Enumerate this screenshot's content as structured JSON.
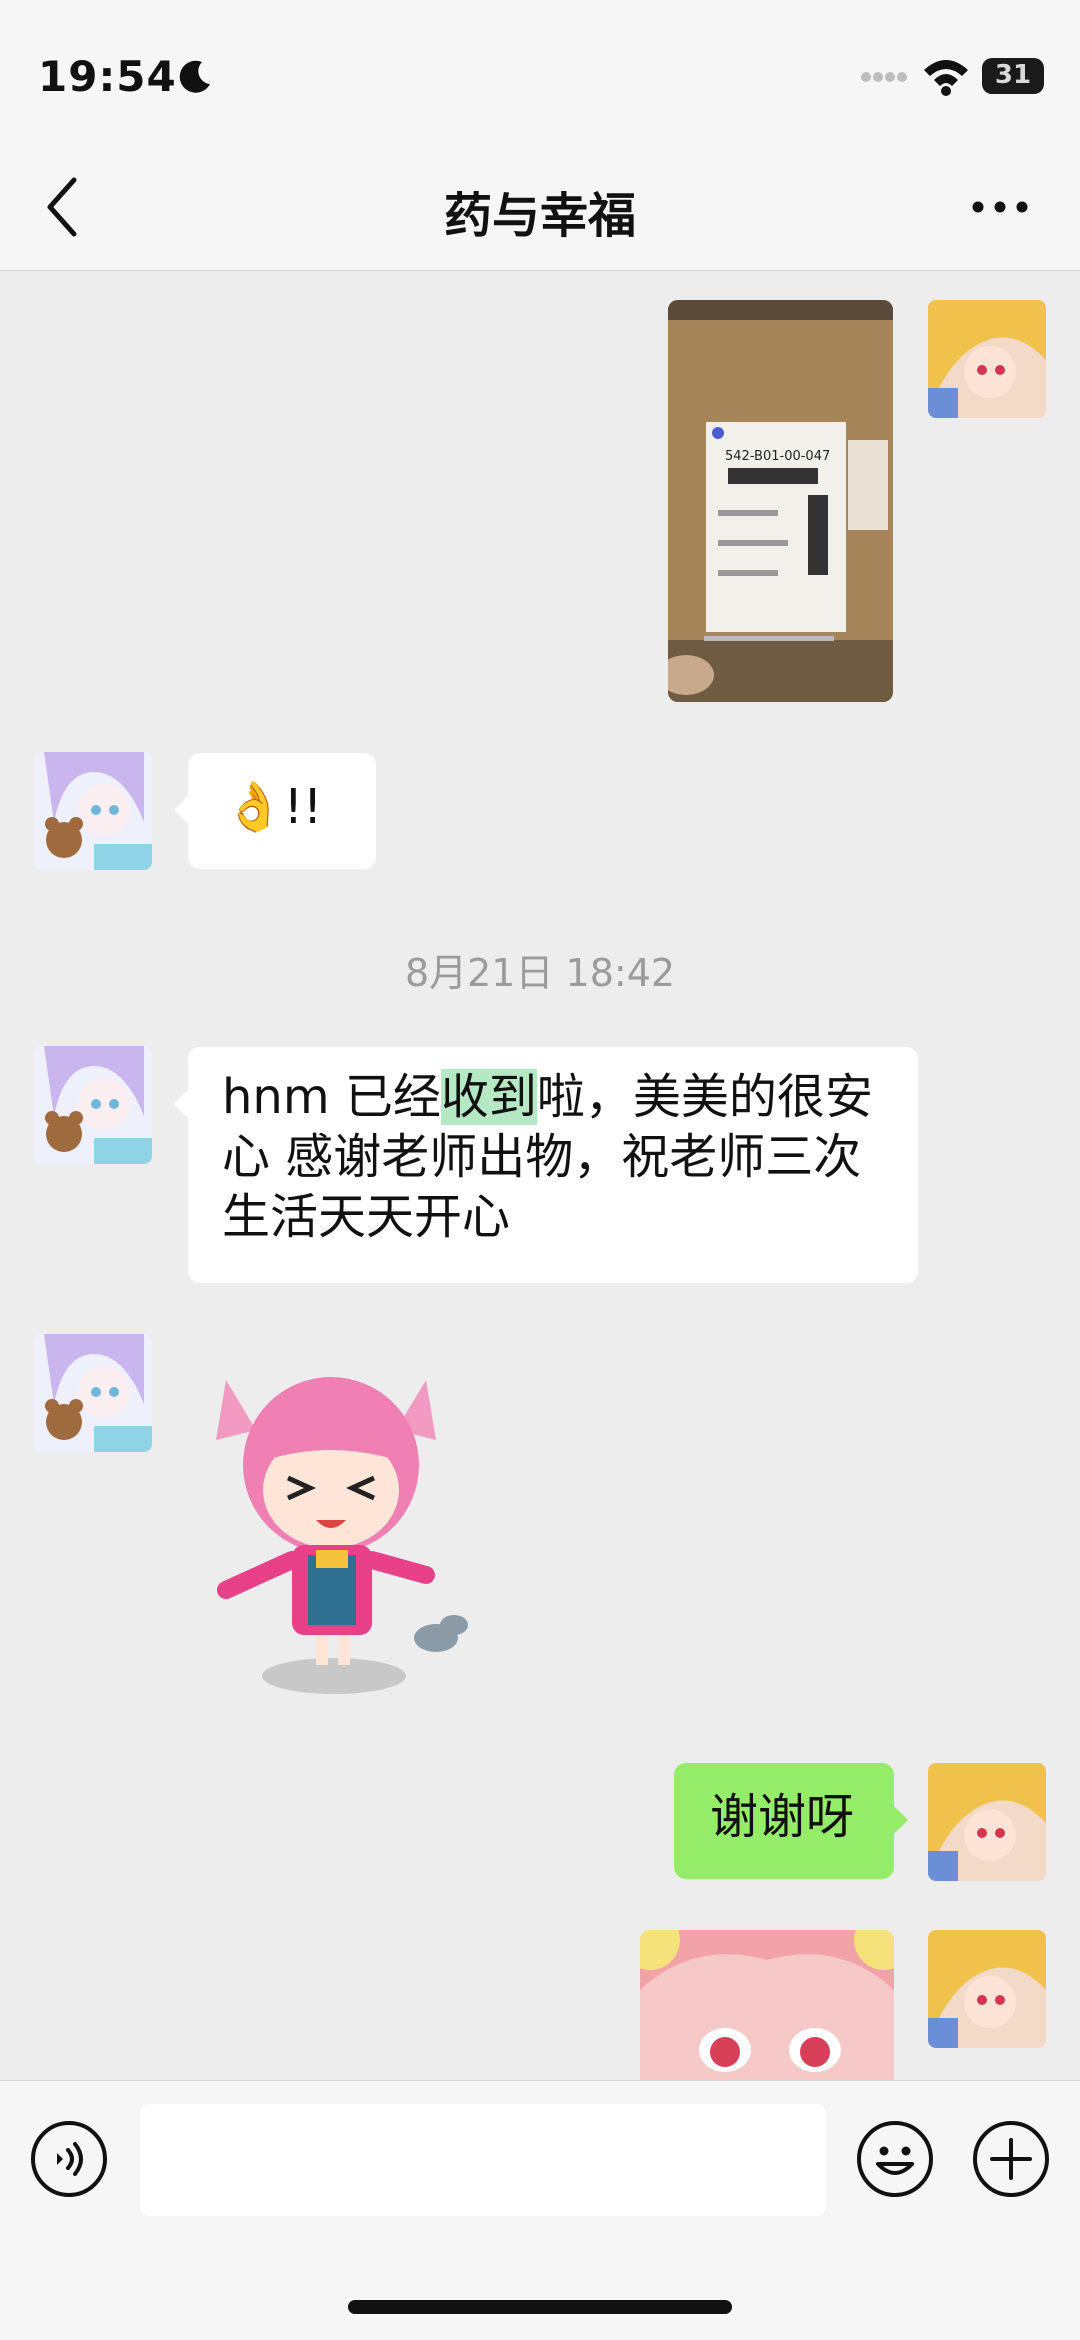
{
  "status_bar": {
    "time": "19:54",
    "battery": "31",
    "icons": [
      "moon-icon",
      "signal-dots-icon",
      "wifi-icon",
      "battery-icon"
    ]
  },
  "nav": {
    "title": "药与幸福",
    "back_icon": "chevron-left-icon",
    "more_icon": "more-dots-icon"
  },
  "messages": {
    "m2_text": "👌!!",
    "timestamp": "8月21日 18:42",
    "m3_part1": "hnm 已经",
    "m3_highlight": "收到",
    "m3_part2": "啦，美美的很安心 感谢老师出物，祝老师三次生活天天开心",
    "m5_text": "谢谢呀"
  },
  "package_label": {
    "code": "542-B01-00-047"
  },
  "input_bar": {
    "icons": [
      "voice-icon",
      "emoji-icon",
      "plus-icon"
    ],
    "value": ""
  },
  "colors": {
    "background": "#ededed",
    "bubble_mine": "#95ec69",
    "bubble_other": "#ffffff",
    "highlight": "#b6e8c3"
  }
}
